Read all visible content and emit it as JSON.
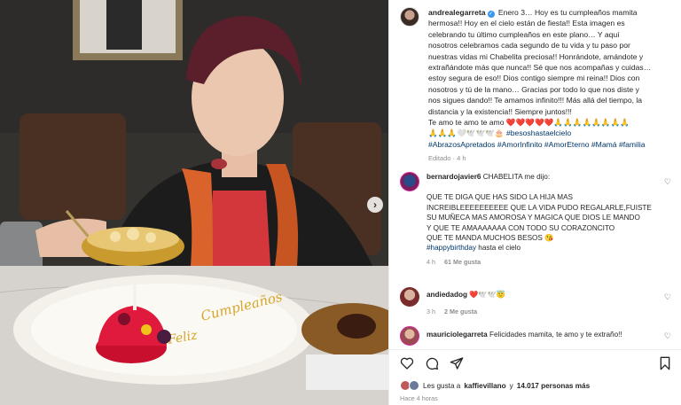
{
  "post": {
    "username": "andrealegarreta",
    "caption_lines": [
      "Enero 3… Hoy es tu cumpleaños mamita",
      "hermosa!! Hoy en el cielo están de fiesta!! Esta imagen es",
      "celebrando tu último cumpleaños en este plano… Y aquí",
      "nosotros celebramos cada segundo de tu vida y tu paso por",
      "nuestras vidas mi Chabelita preciosa!! Honrándote, amándote y",
      "extrañándote más que nunca!! Sé que nos acompañas y cuidas…",
      "estoy segura de eso!! Dios contigo siempre mi reina!! Dios con",
      "nosotros y tú de la mano… Gracias por todo lo que nos diste y",
      "nos sigues dando!! Te amamos infinito!!! Más allá del tiempo, la",
      "distancia y la existencia!! Siempre juntos!!!"
    ],
    "love_line": "Te amo te amo te amo",
    "love_emojis": "❤️❤️❤️❤️❤️🙏🙏🙏🙏🙏🙏🙏🙏",
    "emoji_line": "🙏🙏🙏🤍🕊️🕊️🕊️🎂",
    "hashtags_line1_tag": "#besoshastaelcielo",
    "hashtags_line2": "#AbrazosApretados #AmorInfinito #AmorEterno #Mamá #familia",
    "edited": "Editado · 4 h",
    "photo_cake_text_1": "Cumpleaños",
    "photo_cake_text_2": "Feliz"
  },
  "comments": [
    {
      "username": "bernardojavier6",
      "first": "CHABELITA me dijo:",
      "body": [
        "QUE TE DIGA QUE HAS SIDO LA HIJA MAS",
        "INCREIBLEEEEEEEEEE QUE LA VIDA PUDO REGALARLE,FUISTE",
        "SU MUÑECA MAS AMOROSA Y MAGICA QUE DIOS LE MANDO",
        "Y QUE TE AMAAAAAAA CON TODO SU CORAZONCITO",
        "QUE TE MANDA MUCHOS BESOS 😘"
      ],
      "mention": "#happybirthday",
      "mention_rest": " hasta el cielo",
      "time": "4 h",
      "likes": "61 Me gusta"
    },
    {
      "username": "andiedadog",
      "text": "❤️🕊️🕊️😇",
      "time": "3 h",
      "likes": "2 Me gusta"
    },
    {
      "username": "mauriciolegarreta",
      "text": "Felicidades mamita, te amo y te extraño!!"
    }
  ],
  "likes_summary": {
    "prefix": "Les gusta a",
    "user": "kaffievillano",
    "middle": "y",
    "count": "14.017 personas más"
  },
  "time_ago": "Hace 4 horas",
  "colors": {
    "accent": "#0095f6",
    "hashtag": "#00376b",
    "muted": "#8e8e8e"
  }
}
